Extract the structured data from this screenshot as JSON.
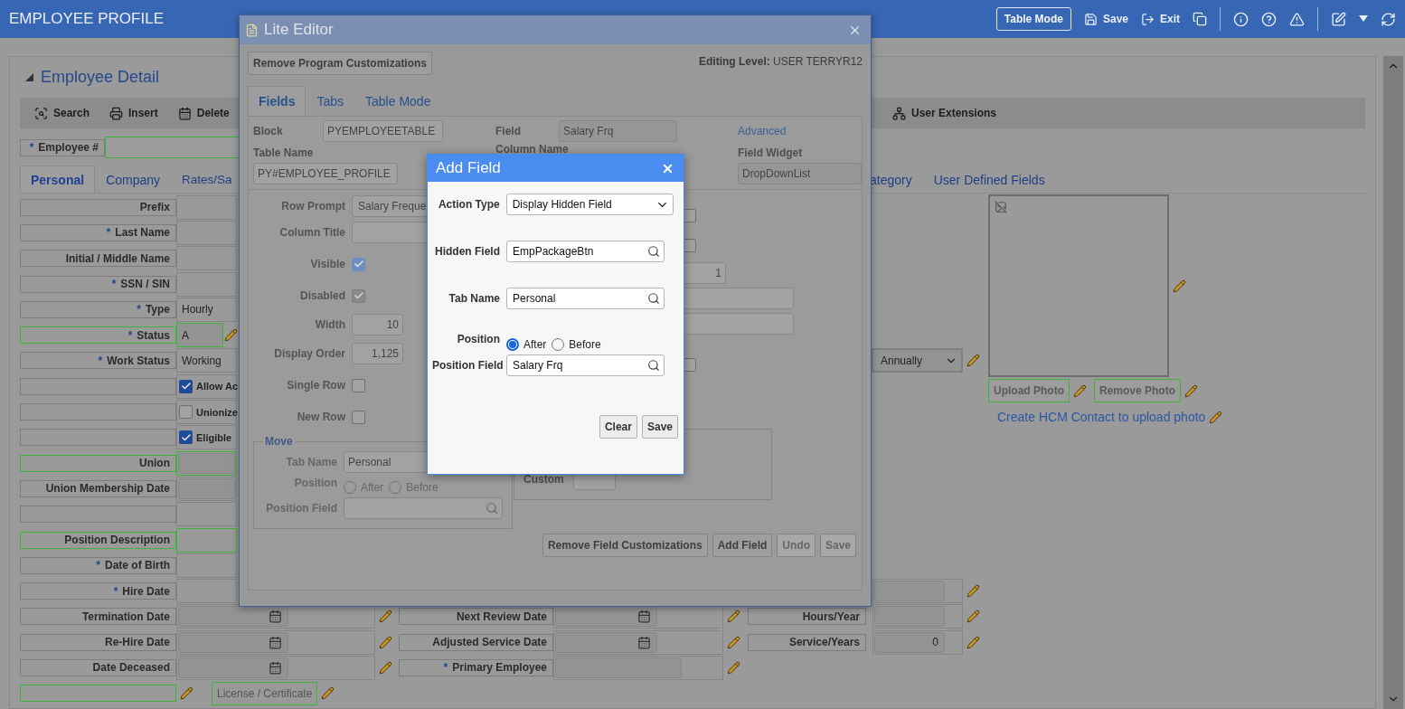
{
  "header": {
    "title": "EMPLOYEE PROFILE",
    "buttons": [
      {
        "label": "Table Mode",
        "kind": "outlined"
      },
      {
        "label": "Save",
        "kind": "save"
      },
      {
        "label": "Exit",
        "kind": "exit"
      }
    ]
  },
  "panel": {
    "title": "Employee Detail",
    "expanded": true,
    "toolbar": [
      {
        "label": "Search",
        "kind": "search"
      },
      {
        "label": "Insert",
        "kind": "insert"
      },
      {
        "label": "Delete",
        "kind": "delete"
      },
      {
        "label": "User Extensions",
        "kind": "extensions"
      }
    ],
    "employee_field": {
      "mark": "*",
      "label": "Employee #"
    },
    "tabs": [
      {
        "label": "Personal",
        "selected": true
      },
      {
        "label": "Company",
        "selected": false
      },
      {
        "label": "Rates/Sa",
        "selected": false
      },
      {
        "label": "ategory",
        "selected": false
      },
      {
        "label": "User Defined Fields",
        "selected": false
      }
    ],
    "left_rows": [
      {
        "label": "Prefix",
        "kind": "text",
        "highlighted": false,
        "editable": false
      },
      {
        "mark": "*",
        "label": "Last Name",
        "kind": "text",
        "highlighted": false,
        "editable": false
      },
      {
        "label": "Initial / Middle Name",
        "kind": "text",
        "highlighted": false,
        "editable": false
      },
      {
        "mark": "*",
        "label": "SSN / SIN",
        "kind": "text",
        "highlighted": false,
        "editable": false
      },
      {
        "mark": "*",
        "label": "Type",
        "kind": "text",
        "value": "Hourly",
        "highlighted": false,
        "editable": false
      },
      {
        "mark": "*",
        "label": "Status",
        "kind": "code",
        "value": "A",
        "highlighted": true,
        "editable": true
      },
      {
        "mark": "*",
        "label": "Work Status",
        "kind": "text",
        "value": "Working",
        "highlighted": false,
        "editable": false
      },
      {
        "kind": "check",
        "value": "Allow Ac",
        "checked": true,
        "highlighted": false,
        "editable": false
      },
      {
        "kind": "check",
        "value": "Unionize",
        "checked": false,
        "highlighted": false,
        "editable": false
      },
      {
        "kind": "check",
        "value": "Eligible",
        "checked": true,
        "highlighted": false,
        "editable": false
      },
      {
        "label": "Union",
        "kind": "gray",
        "highlighted": true,
        "editable": false
      },
      {
        "label": "Union Membership Date",
        "kind": "gray",
        "highlighted": false,
        "editable": false
      },
      {
        "kind": "text",
        "highlighted": false,
        "editable": false
      },
      {
        "label": "Position Description",
        "kind": "text",
        "highlighted": true,
        "editable": false
      },
      {
        "mark": "*",
        "label": "Date of Birth",
        "kind": "text",
        "highlighted": false,
        "editable": false
      },
      {
        "mark": "*",
        "label": "Hire Date",
        "kind": "text",
        "highlighted": false,
        "editable": false
      },
      {
        "label": "Termination Date",
        "kind": "date",
        "highlighted": false,
        "editable": true
      },
      {
        "label": "Re-Hire Date",
        "kind": "date",
        "highlighted": false,
        "editable": true
      },
      {
        "label": "Date Deceased",
        "kind": "date",
        "highlighted": false,
        "editable": true
      },
      {
        "kind": "button",
        "value": "License / Certificate",
        "highlighted": true,
        "editable": true
      }
    ],
    "middle_rows": [
      {
        "label": "Next Review Date",
        "kind": "date",
        "editable": true
      },
      {
        "label": "Adjusted Service Date",
        "kind": "date",
        "editable": true
      },
      {
        "mark": "*",
        "label": "Primary Employee",
        "kind": "gray",
        "editable": true
      }
    ],
    "right_rows": [
      {
        "kind": "select",
        "value": "Annually",
        "editable": true
      },
      {
        "kind": "text",
        "editable": true
      },
      {
        "label": "Hours/Year",
        "kind": "text",
        "editable": true
      },
      {
        "label": "Service/Years",
        "kind": "text",
        "value": "0",
        "editable": true
      }
    ],
    "photo": {
      "buttons": [
        "Upload Photo",
        "Remove Photo"
      ],
      "link": "Create HCM Contact to upload photo"
    }
  },
  "lite_editor": {
    "title": "Lite Editor",
    "remove_button": "Remove Program Customizations",
    "editing_level": {
      "label": "Editing Level:",
      "value": "USER TERRYR12"
    },
    "tabs": [
      {
        "label": "Fields",
        "selected": true
      },
      {
        "label": "Tabs",
        "selected": false
      },
      {
        "label": "Table Mode",
        "selected": false
      }
    ],
    "block": {
      "label": "Block",
      "value": "PYEMPLOYEETABLE"
    },
    "field": {
      "label": "Field",
      "value": "Salary Frq"
    },
    "advanced": "Advanced",
    "table_name": {
      "label": "Table Name",
      "value": "PY#EMPLOYEE_PROFILE"
    },
    "column_name": {
      "label": "Column Name"
    },
    "field_widget": {
      "label": "Field Widget",
      "value": "DropDownList"
    },
    "properties": [
      {
        "label": "Row Prompt",
        "kind": "text",
        "value": "Salary Freque"
      },
      {
        "label": "Column Title",
        "kind": "text"
      },
      {
        "label": "Visible",
        "kind": "check",
        "checked": true,
        "disabled": false
      },
      {
        "label": "Disabled",
        "kind": "check",
        "checked": true,
        "disabled": true
      },
      {
        "label": "Width",
        "kind": "number",
        "value": "10"
      },
      {
        "label": "Display Order",
        "kind": "number",
        "value": "1,125"
      },
      {
        "label": "Single Row",
        "kind": "check",
        "checked": false,
        "disabled": false
      },
      {
        "label": "New Row",
        "kind": "check",
        "checked": false,
        "disabled": false
      }
    ],
    "move": {
      "legend": "Move",
      "tab_name": {
        "label": "Tab Name",
        "value": "Personal"
      },
      "position": {
        "label": "Position",
        "options": [
          {
            "label": "After",
            "selected": false
          },
          {
            "label": "Before",
            "selected": false
          }
        ]
      },
      "position_field": {
        "label": "Position Field"
      }
    },
    "side_controls": [
      {
        "kind": "check",
        "checked": false
      },
      {
        "kind": "check",
        "checked": false
      },
      {
        "kind": "number",
        "value": "1"
      },
      {
        "kind": "text"
      },
      {
        "kind": "text"
      },
      {
        "kind": "check",
        "checked": false
      }
    ],
    "custom": {
      "label": "Custom"
    },
    "buttons": [
      {
        "label": "Remove Field Customizations",
        "disabled": false
      },
      {
        "label": "Add Field",
        "disabled": false
      },
      {
        "label": "Undo",
        "disabled": true
      },
      {
        "label": "Save",
        "disabled": true
      }
    ]
  },
  "add_field": {
    "title": "Add Field",
    "action_type": {
      "label": "Action Type",
      "value": "Display Hidden Field"
    },
    "hidden_field": {
      "label": "Hidden Field",
      "value": "EmpPackageBtn"
    },
    "tab_name": {
      "label": "Tab Name",
      "value": "Personal"
    },
    "position": {
      "label": "Position",
      "options": [
        {
          "label": "After",
          "selected": true
        },
        {
          "label": "Before",
          "selected": false
        }
      ]
    },
    "position_field": {
      "label": "Position Field",
      "value": "Salary Frq"
    },
    "buttons": [
      "Clear",
      "Save"
    ]
  }
}
